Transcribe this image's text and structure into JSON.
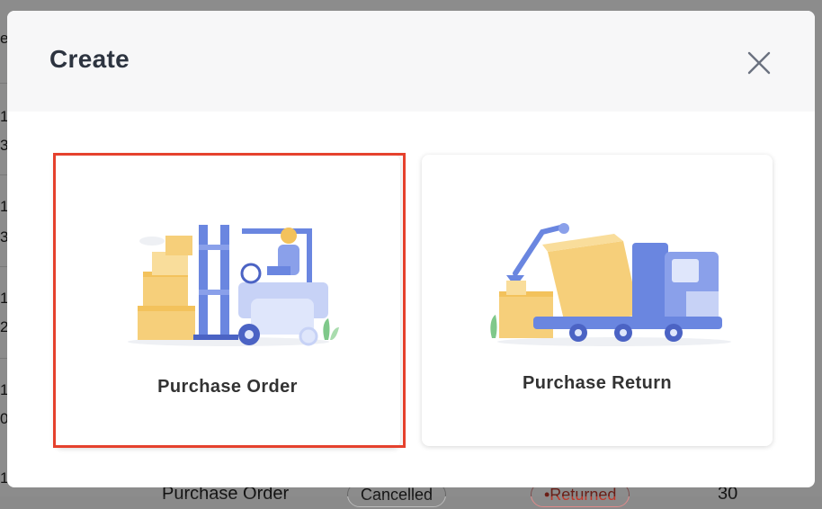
{
  "background": {
    "left_chars": [
      "e",
      "1",
      "3",
      "1",
      "3",
      "1",
      "2",
      "1",
      "0",
      "1"
    ],
    "bottom_row": {
      "type": "Purchase Order",
      "status": "Cancelled",
      "return_status": "•Returned",
      "count": "30"
    }
  },
  "modal": {
    "title": "Create",
    "close_icon": "close-icon",
    "options": [
      {
        "label": "Purchase Order",
        "icon": "forklift-illustration",
        "selected": true
      },
      {
        "label": "Purchase Return",
        "icon": "truck-return-illustration",
        "selected": false
      }
    ]
  },
  "colors": {
    "highlight": "#e5412d",
    "illustration_blue": "#6a86e0",
    "illustration_box": "#f6cf7a"
  }
}
